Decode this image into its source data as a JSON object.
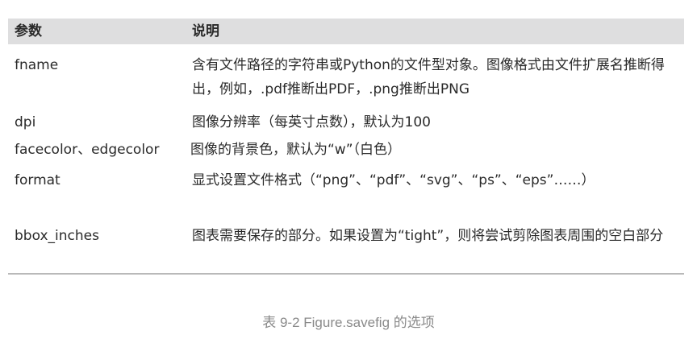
{
  "table": {
    "headers": [
      "参数",
      "说明"
    ],
    "rows": [
      {
        "param": "fname",
        "desc": "含有文件路径的字符串或Python的文件型对象。图像格式由文件扩展名推断得出，例如，.pdf推断出PDF，.png推断出PNG"
      },
      {
        "param": "dpi",
        "desc": "图像分辨率（每英寸点数），默认为100"
      },
      {
        "param": "facecolor、edgecolor",
        "desc": "图像的背景色，默认为“w”（白色）"
      },
      {
        "param": "format",
        "desc": "显式设置文件格式（“png”、“pdf”、“svg”、“ps”、“eps”……）"
      },
      {
        "param": "bbox_inches",
        "desc": "图表需要保存的部分。如果设置为“tight”，则将尝试剪除图表周围的空白部分"
      }
    ]
  },
  "caption": "表 9-2 Figure.savefig 的选项"
}
